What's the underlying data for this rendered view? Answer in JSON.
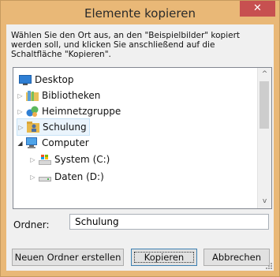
{
  "window": {
    "title": "Elemente kopieren",
    "close_symbol": "✕"
  },
  "message": "Wählen Sie den Ort aus, an den \"Beispielbilder\" kopiert werden soll, und klicken Sie anschließend auf die Schaltfläche \"Kopieren\".",
  "tree": {
    "items": [
      {
        "label": "Desktop",
        "icon": "desktop-icon"
      },
      {
        "label": "Bibliotheken",
        "icon": "libraries-icon"
      },
      {
        "label": "Heimnetzgruppe",
        "icon": "homegroup-icon"
      },
      {
        "label": "Schulung",
        "icon": "user-folder-icon",
        "selected": true
      },
      {
        "label": "Computer",
        "icon": "computer-icon",
        "expanded": true
      },
      {
        "label": "System (C:)",
        "icon": "system-drive-icon"
      },
      {
        "label": "Daten (D:)",
        "icon": "drive-icon"
      }
    ]
  },
  "folder": {
    "label": "Ordner:",
    "value": "Schulung"
  },
  "buttons": {
    "new_folder": "Neuen Ordner erstellen",
    "copy": "Kopieren",
    "cancel": "Abbrechen"
  }
}
